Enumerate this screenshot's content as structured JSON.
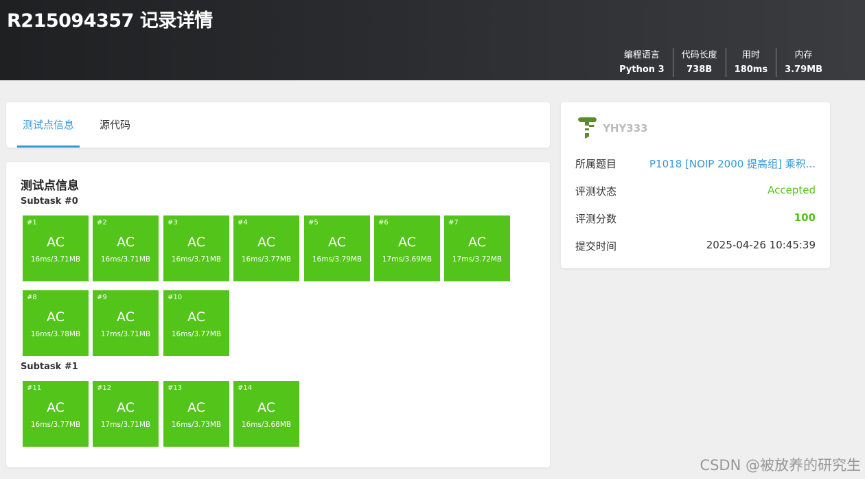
{
  "header": {
    "title": "R215094357 记录详情",
    "stats": [
      {
        "label": "编程语言",
        "value": "Python 3"
      },
      {
        "label": "代码长度",
        "value": "738B"
      },
      {
        "label": "用时",
        "value": "180ms"
      },
      {
        "label": "内存",
        "value": "3.79MB"
      }
    ]
  },
  "tabs": {
    "testcases": "测试点信息",
    "source": "源代码"
  },
  "cases": {
    "title": "测试点信息",
    "subtasks": [
      {
        "name": "Subtask #0",
        "tests": [
          {
            "num": "#1",
            "status": "AC",
            "detail": "16ms/3.71MB"
          },
          {
            "num": "#2",
            "status": "AC",
            "detail": "16ms/3.71MB"
          },
          {
            "num": "#3",
            "status": "AC",
            "detail": "16ms/3.71MB"
          },
          {
            "num": "#4",
            "status": "AC",
            "detail": "16ms/3.77MB"
          },
          {
            "num": "#5",
            "status": "AC",
            "detail": "16ms/3.79MB"
          },
          {
            "num": "#6",
            "status": "AC",
            "detail": "17ms/3.69MB"
          },
          {
            "num": "#7",
            "status": "AC",
            "detail": "17ms/3.72MB"
          },
          {
            "num": "#8",
            "status": "AC",
            "detail": "16ms/3.78MB"
          },
          {
            "num": "#9",
            "status": "AC",
            "detail": "17ms/3.71MB"
          },
          {
            "num": "#10",
            "status": "AC",
            "detail": "16ms/3.77MB"
          }
        ]
      },
      {
        "name": "Subtask #1",
        "tests": [
          {
            "num": "#11",
            "status": "AC",
            "detail": "16ms/3.77MB"
          },
          {
            "num": "#12",
            "status": "AC",
            "detail": "17ms/3.71MB"
          },
          {
            "num": "#13",
            "status": "AC",
            "detail": "16ms/3.73MB"
          },
          {
            "num": "#14",
            "status": "AC",
            "detail": "16ms/3.68MB"
          }
        ]
      }
    ]
  },
  "info": {
    "username": "YHY333",
    "user_icon": "user-badge-icon",
    "rows": [
      {
        "label": "所属题目",
        "value": "P1018 [NOIP 2000 提高组] 乘积..."
      },
      {
        "label": "评测状态",
        "value": "Accepted"
      },
      {
        "label": "评测分数",
        "value": "100"
      },
      {
        "label": "提交时间",
        "value": "2025-04-26 10:45:39"
      }
    ]
  },
  "watermark": "CSDN @被放养的研究生",
  "colors": {
    "accepted": "#52c41a",
    "link": "#3498db",
    "header_bg": "#2b2c2f",
    "page_bg": "#efefef"
  }
}
